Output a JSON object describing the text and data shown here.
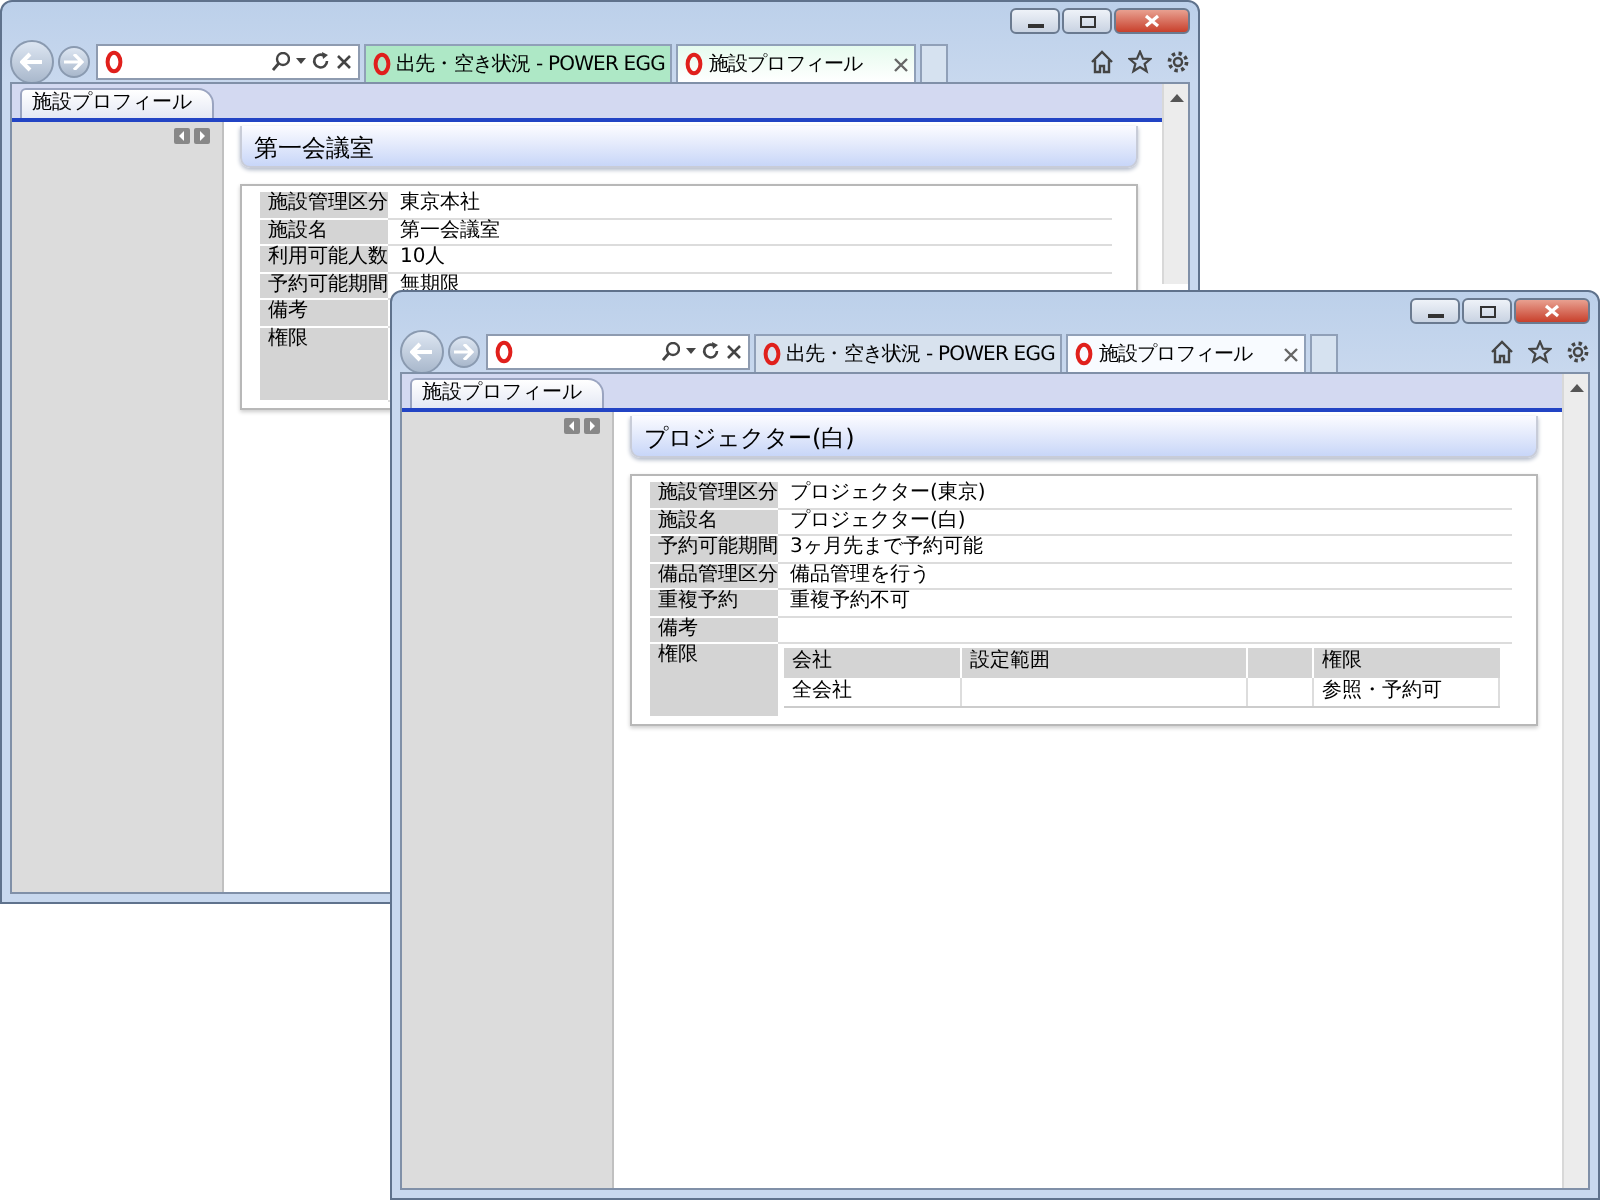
{
  "windows": [
    {
      "tabs": [
        {
          "label": "出先・空き状況 - POWER EGG",
          "selected": false
        },
        {
          "label": "施設プロフィール",
          "selected": true
        }
      ],
      "page_tab": "施設プロフィール",
      "heading": "第一会議室",
      "rows": [
        {
          "label": "施設管理区分",
          "value": "東京本社"
        },
        {
          "label": "施設名",
          "value": "第一会議室"
        },
        {
          "label": "利用可能人数",
          "value": "10人"
        },
        {
          "label": "予約可能期間",
          "value": "無期限"
        },
        {
          "label": "備考"
        },
        {
          "label": "権限"
        }
      ]
    },
    {
      "tabs": [
        {
          "label": "出先・空き状況 - POWER EGG",
          "selected": false
        },
        {
          "label": "施設プロフィール",
          "selected": true
        }
      ],
      "page_tab": "施設プロフィール",
      "heading": "プロジェクター(白)",
      "rows": [
        {
          "label": "施設管理区分",
          "value": "プロジェクター(東京)"
        },
        {
          "label": "施設名",
          "value": "プロジェクター(白)"
        },
        {
          "label": "予約可能期間",
          "value": "3ヶ月先まで予約可能"
        },
        {
          "label": "備品管理区分",
          "value": "備品管理を行う"
        },
        {
          "label": "重複予約",
          "value": "重複予約不可"
        },
        {
          "label": "備考"
        },
        {
          "label": "権限",
          "permissions": {
            "columns": {
              "company": "会社",
              "range": "設定範囲",
              "rights": "権限"
            },
            "rows": [
              {
                "company": "全会社",
                "rights": "参照・予約可"
              }
            ]
          }
        }
      ]
    }
  ]
}
